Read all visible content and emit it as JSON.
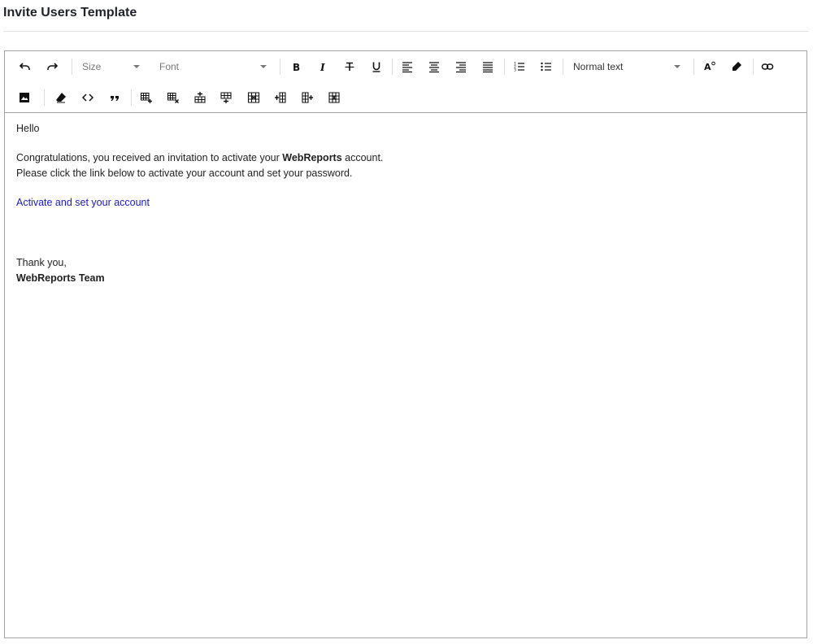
{
  "page": {
    "title": "Invite Users Template"
  },
  "toolbar": {
    "size_placeholder": "Size",
    "font_placeholder": "Font",
    "block_format": "Normal text",
    "icons": {
      "undo": "undo-icon",
      "redo": "redo-icon",
      "bold": "bold-icon",
      "italic": "italic-icon",
      "strike": "strikethrough-icon",
      "underline": "underline-icon",
      "align_left": "align-left-icon",
      "align_center": "align-center-icon",
      "align_right": "align-right-icon",
      "align_justify": "align-justify-icon",
      "ordered_list": "ordered-list-icon",
      "bullet_list": "bullet-list-icon",
      "font_color": "font-color-icon",
      "highlight": "highlight-icon",
      "link": "link-icon",
      "image": "image-icon",
      "clear_format": "eraser-icon",
      "code": "code-icon",
      "quote": "quote-icon",
      "table_insert": "table-insert-icon",
      "table_delete": "table-delete-icon",
      "row_above": "insert-row-above-icon",
      "row_below": "insert-row-below-icon",
      "row_delete": "delete-row-icon",
      "col_left": "insert-column-left-icon",
      "col_right": "insert-column-right-icon",
      "col_delete": "delete-column-icon"
    }
  },
  "body": {
    "greeting": "Hello",
    "line1_pre": "Congratulations, you received an invitation to activate your ",
    "line1_bold": "WebReports",
    "line1_post": " account.",
    "line2": "Please click the link below to activate your account and set your password.",
    "link_text": "Activate and set your account",
    "closing": "Thank you,",
    "signature": "WebReports Team"
  },
  "colors": {
    "link": "#1a1ab8",
    "border": "#a3a3a3"
  }
}
